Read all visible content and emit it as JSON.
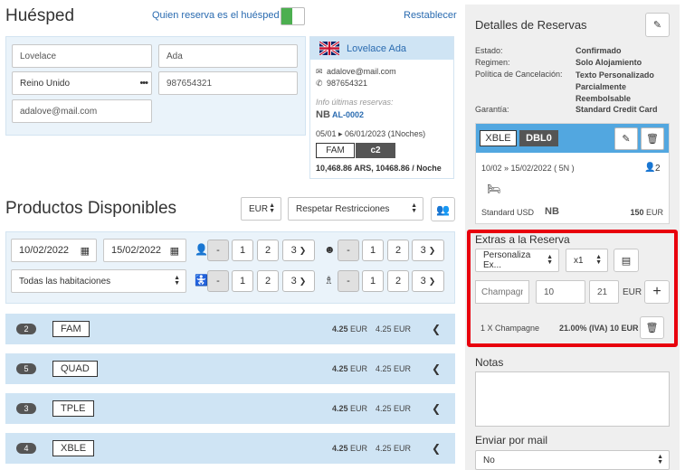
{
  "guest": {
    "title": "Huésped",
    "toggle_label": "Quien reserva es el huésped",
    "reset": "Restablecer",
    "first_name": "Lovelace",
    "last_name": "Ada",
    "country": "Reino Unido",
    "phone": "987654321",
    "email": "adalove@mail.com"
  },
  "guest_card": {
    "name": "Lovelace Ada",
    "email": "adalove@mail.com",
    "phone": "987654321",
    "history_label": "Info últimas reservas:",
    "code_prefix": "NB",
    "code": "AL-0002",
    "dates": "05/01 ▸ 06/01/2023 (1Noches)",
    "tag1": "FAM",
    "tag2": "c2",
    "price": "10,468.86 ARS, 10468.86 / Noche"
  },
  "products": {
    "title": "Productos Disponibles",
    "currency": "EUR",
    "restrictions": "Respetar Restricciones",
    "date_from": "10/02/2022",
    "date_to": "15/02/2022",
    "rooms_select": "Todas las habitaciones",
    "counter_labels": [
      "-",
      "1",
      "2",
      "3"
    ]
  },
  "room_groups": [
    {
      "count": "2",
      "code": "FAM",
      "price1": "4.25",
      "price2": "4.25 EUR",
      "currency": "EUR"
    },
    {
      "count": "5",
      "code": "QUAD",
      "price1": "4.25",
      "price2": "4.25 EUR",
      "currency": "EUR"
    },
    {
      "count": "3",
      "code": "TPLE",
      "price1": "4.25",
      "price2": "4.25 EUR",
      "currency": "EUR"
    },
    {
      "count": "4",
      "code": "XBLE",
      "price1": "4.25",
      "price2": "4.25 EUR",
      "currency": "EUR"
    }
  ],
  "booking": {
    "title": "Detalles de Reservas",
    "estado_label": "Estado:",
    "estado_value": "Confirmado",
    "regimen_label": "Regimen:",
    "regimen_value": "Solo Alojamiento",
    "politica_label": "Política de Cancelación:",
    "politica_value": "Texto Personalizado Parcialmente Reembolsable",
    "garantia_label": "Garantía:",
    "garantia_value": "Standard Credit Card",
    "room_tag1": "XBLE",
    "room_tag2": "DBL0",
    "room_dates": "10/02 » 15/02/2022 ( 5N )",
    "room_guests": "2",
    "rate_name": "Standard USD",
    "rate_code": "NB",
    "rate_price": "150",
    "rate_currency": "EUR"
  },
  "extras": {
    "title": "Extras a la Reserva",
    "select": "Personaliza Ex...",
    "qty": "x1",
    "name_placeholder": "Champagne",
    "price": "10",
    "tax": "21",
    "currency": "EUR",
    "line_desc": "1 X Champagne",
    "line_tax": "21.00% (IVA)",
    "line_price": "10 EUR"
  },
  "notes": {
    "title": "Notas"
  },
  "mail": {
    "title": "Enviar por mail",
    "value": "No"
  },
  "colors": {
    "accent_blue": "#52a7e0",
    "light_blue": "#cfe4f4",
    "highlight_red": "#e8000d",
    "toggle_green": "#4caf50"
  }
}
